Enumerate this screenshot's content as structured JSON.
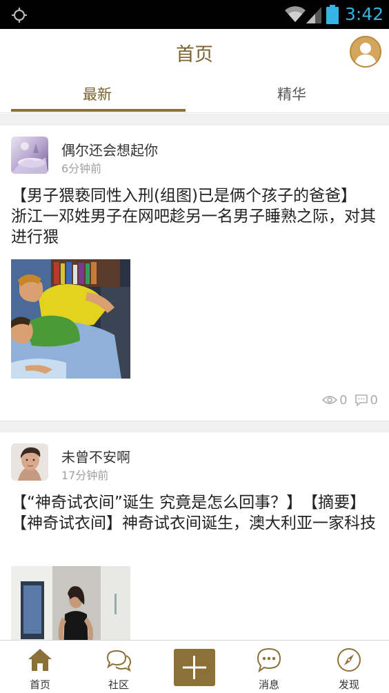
{
  "status_bar": {
    "time": "3:42"
  },
  "header": {
    "title": "首页"
  },
  "tabs": [
    {
      "label": "最新"
    },
    {
      "label": "精华"
    }
  ],
  "posts": [
    {
      "username": "偶尔还会想起你",
      "time": "6分钟前",
      "text": "【男子猥亵同性入刑(组图)已是俩个孩子的爸爸】　　浙江一邓姓男子在网吧趁另一名男子睡熟之际，对其进行猥",
      "views": "0",
      "comments": "0"
    },
    {
      "username": "未曾不安啊",
      "time": "17分钟前",
      "text": "【“神奇试衣间”诞生 究竟是怎么回事？】　【摘要】【神奇试衣间】神奇试衣间诞生，澳大利亚一家科技"
    }
  ],
  "bottom_nav": [
    {
      "label": "首页",
      "icon": "home-icon"
    },
    {
      "label": "社区",
      "icon": "chat-bubbles-icon"
    },
    {
      "label": "",
      "icon": "plus-icon"
    },
    {
      "label": "消息",
      "icon": "message-icon"
    },
    {
      "label": "发现",
      "icon": "compass-icon"
    }
  ],
  "colors": {
    "accent": "#8b7137",
    "title": "#7a6230",
    "status_time": "#33b5e5"
  }
}
